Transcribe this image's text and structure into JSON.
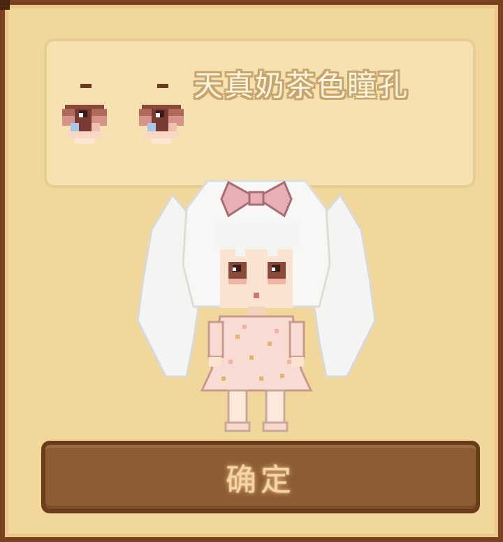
{
  "item": {
    "name": "天真奶茶色瞳孔",
    "icon": "eye-pair-icon"
  },
  "character": {
    "icon": "pixel-girl-avatar"
  },
  "actions": {
    "confirm_label": "确定"
  },
  "colors": {
    "panel": "#f2d79b",
    "panel_border": "#7a4220",
    "info_box": "#f7e1b0",
    "button": "#8c5c34",
    "button_text": "#f4d4a8"
  }
}
